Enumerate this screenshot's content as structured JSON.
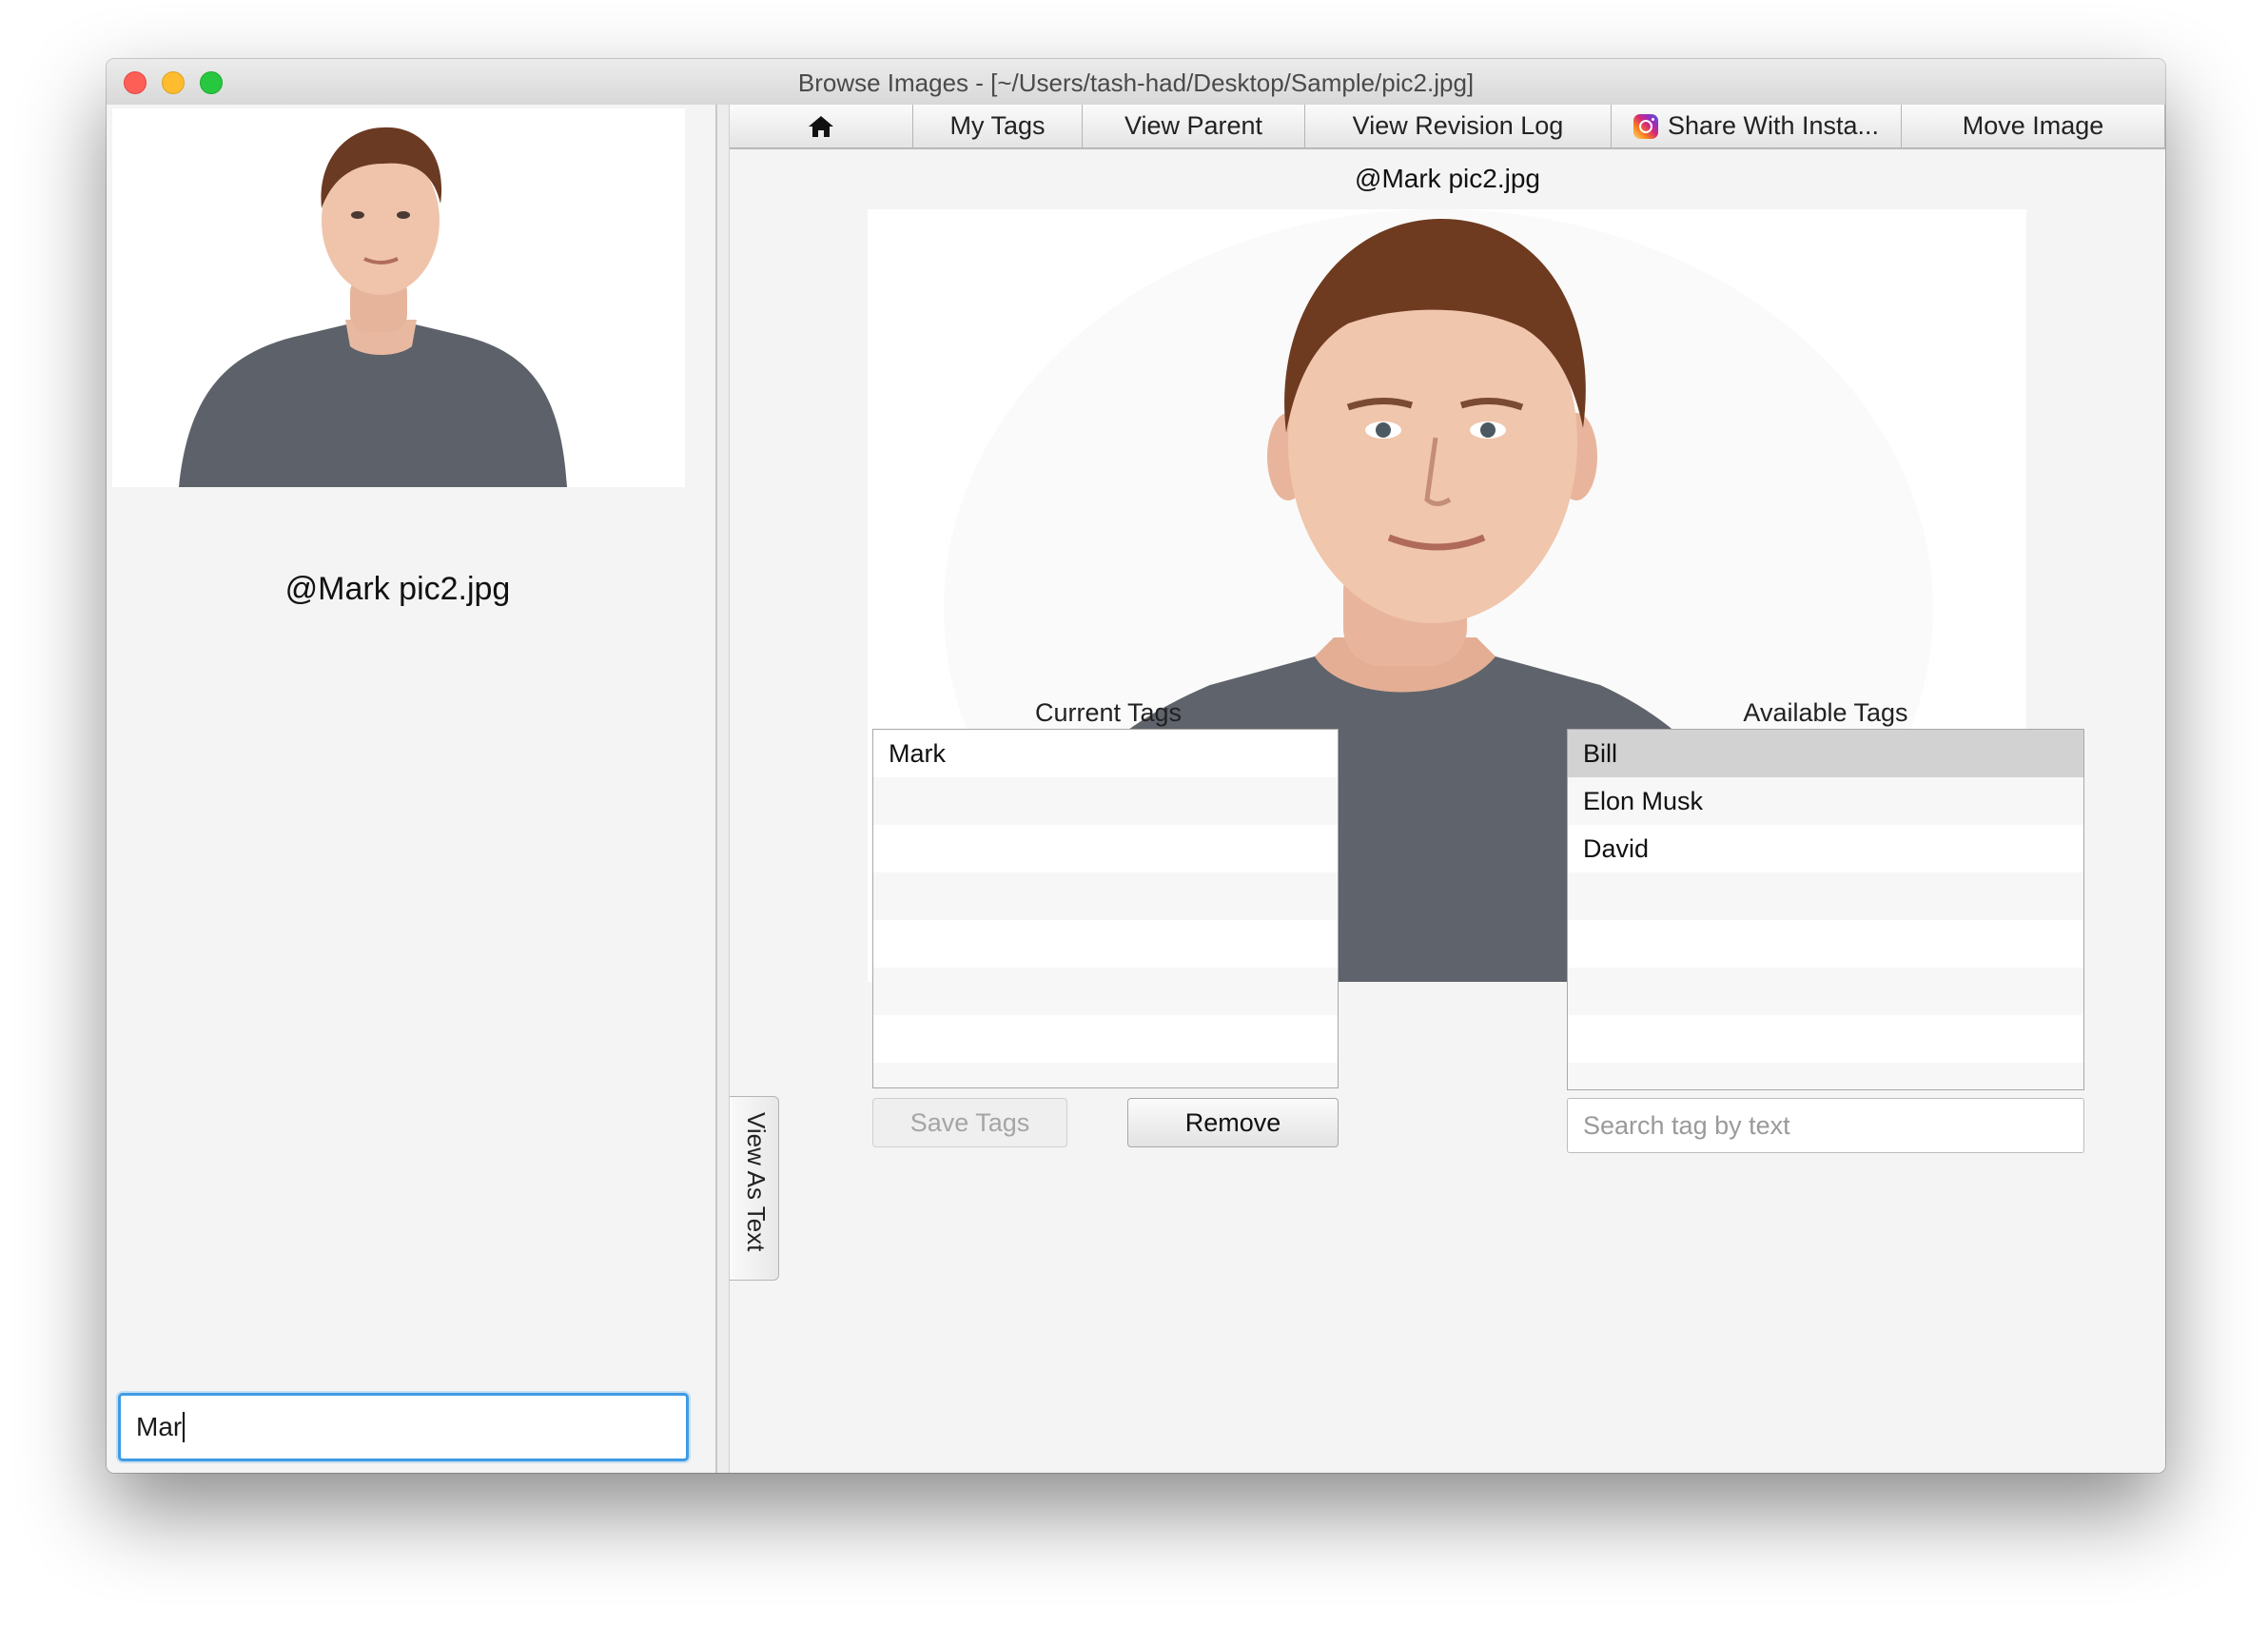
{
  "window": {
    "title": "Browse Images - [~/Users/tash-had/Desktop/Sample/pic2.jpg]"
  },
  "left_pane": {
    "thumbnail_caption": "@Mark pic2.jpg",
    "filter_value": "Mar"
  },
  "toolbar": {
    "home_icon": "home-icon",
    "my_tags": "My Tags",
    "view_parent": "View Parent",
    "view_revision_log": "View Revision Log",
    "share": "Share With Insta...",
    "share_icon": "instagram-icon",
    "move_image": "Move Image"
  },
  "viewer": {
    "caption": "@Mark pic2.jpg",
    "side_tab": "View As Text"
  },
  "current_tags": {
    "header": "Current Tags",
    "items": [
      "Mark"
    ],
    "save_label": "Save Tags",
    "remove_label": "Remove"
  },
  "available_tags": {
    "header": "Available Tags",
    "items": [
      "Bill",
      "Elon Musk",
      "David"
    ],
    "selected": "Bill",
    "search_placeholder": "Search tag by text"
  },
  "colors": {
    "focus_ring": "#3e9be5",
    "selection": "#d2d2d2"
  }
}
